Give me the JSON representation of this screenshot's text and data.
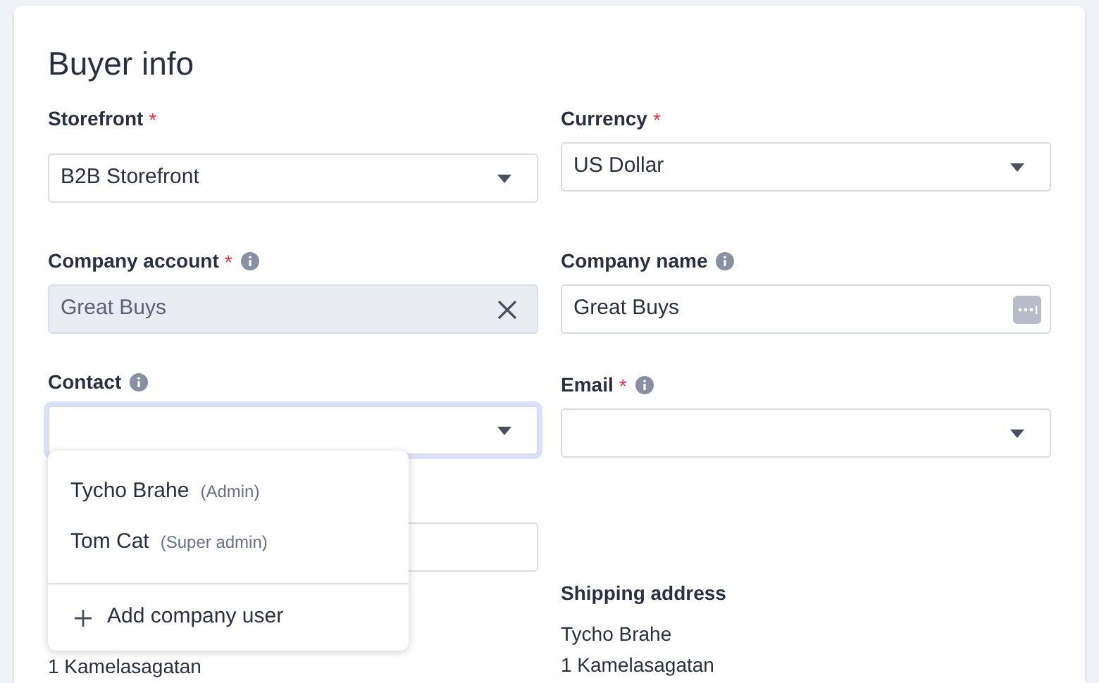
{
  "title": "Buyer info",
  "left_fields": [
    {
      "label": "Storefront",
      "required_mark": "*",
      "info": false,
      "kind": "select",
      "value": "B2B Storefront",
      "locked": false,
      "focused": false
    },
    {
      "label": "Company account",
      "required_mark": "*",
      "info": true,
      "kind": "clearable",
      "value": "Great Buys",
      "locked": true,
      "focused": false
    },
    {
      "label": "Contact",
      "info": true,
      "kind": "select",
      "locked": false,
      "focused": true
    }
  ],
  "right_fields": [
    {
      "label": "Currency",
      "required_mark": "*",
      "info": false,
      "kind": "select",
      "value": "US Dollar",
      "locked": false,
      "focused": false
    },
    {
      "label": "Company name",
      "info": true,
      "kind": "text",
      "value": "Great Buys",
      "locked": false,
      "focused": false
    },
    {
      "label": "Email",
      "required_mark": "*",
      "info": true,
      "kind": "select",
      "locked": false,
      "focused": false
    }
  ],
  "billing_address": {
    "lines": [
      "1 Kamelasagatan"
    ]
  },
  "shipping_address": {
    "heading": "Shipping address",
    "lines": [
      "Tycho Brahe",
      "1 Kamelasagatan"
    ]
  },
  "contact_menu": {
    "options": [
      {
        "name": "Tycho Brahe",
        "role": "(Admin)"
      },
      {
        "name": "Tom Cat",
        "role": "(Super admin)"
      }
    ],
    "action": "Add company user"
  }
}
